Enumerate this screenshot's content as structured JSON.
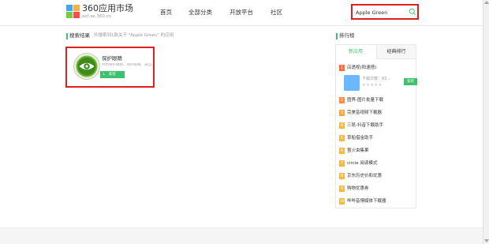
{
  "header": {
    "logo_title": "360应用市场",
    "logo_sub": "ext.se.360.cn",
    "nav": [
      "首页",
      "全部分类",
      "开放平台",
      "社区"
    ]
  },
  "search": {
    "value": "Apple Green"
  },
  "results": {
    "title": "搜索结果",
    "count_text": "共搜索到1款关于 \"Apple Green\" 的应用"
  },
  "app": {
    "name": "保护眼睛",
    "desc": "绿色保护眼睛，保护眼睛，来自A...",
    "install_label": "安装"
  },
  "ranking": {
    "title": "排行榜",
    "tabs": [
      "新应用",
      "经典排行"
    ],
    "items": [
      {
        "num": "1",
        "name": "店透视(阳速搭)",
        "color": "#ff6b3d"
      },
      {
        "num": "2",
        "name": "图界-图片批量下载",
        "color": "#ff8a3d"
      },
      {
        "num": "3",
        "name": "完美音视频下载器",
        "color": "#ffa53d"
      },
      {
        "num": "4",
        "name": "三昆-抖音下载助手",
        "color": "#f5b942"
      },
      {
        "num": "5",
        "name": "草船借金助手",
        "color": "#f5b942"
      },
      {
        "num": "6",
        "name": "萤火虫集果",
        "color": "#f5b942"
      },
      {
        "num": "7",
        "name": "circle 阅读模式",
        "color": "#f5b942"
      },
      {
        "num": "8",
        "name": "京东历史价和优惠",
        "color": "#f5b942"
      },
      {
        "num": "9",
        "name": "购物优惠券",
        "color": "#f5b942"
      },
      {
        "num": "10",
        "name": "哔哔音博媒体下载器",
        "color": "#f5b942"
      }
    ],
    "featured": {
      "downloads": "下载次数：63...",
      "stars": "★★★★★",
      "install_label": "安装"
    }
  },
  "colors": {
    "accent": "#3ec16e",
    "highlight": "#e02020"
  }
}
